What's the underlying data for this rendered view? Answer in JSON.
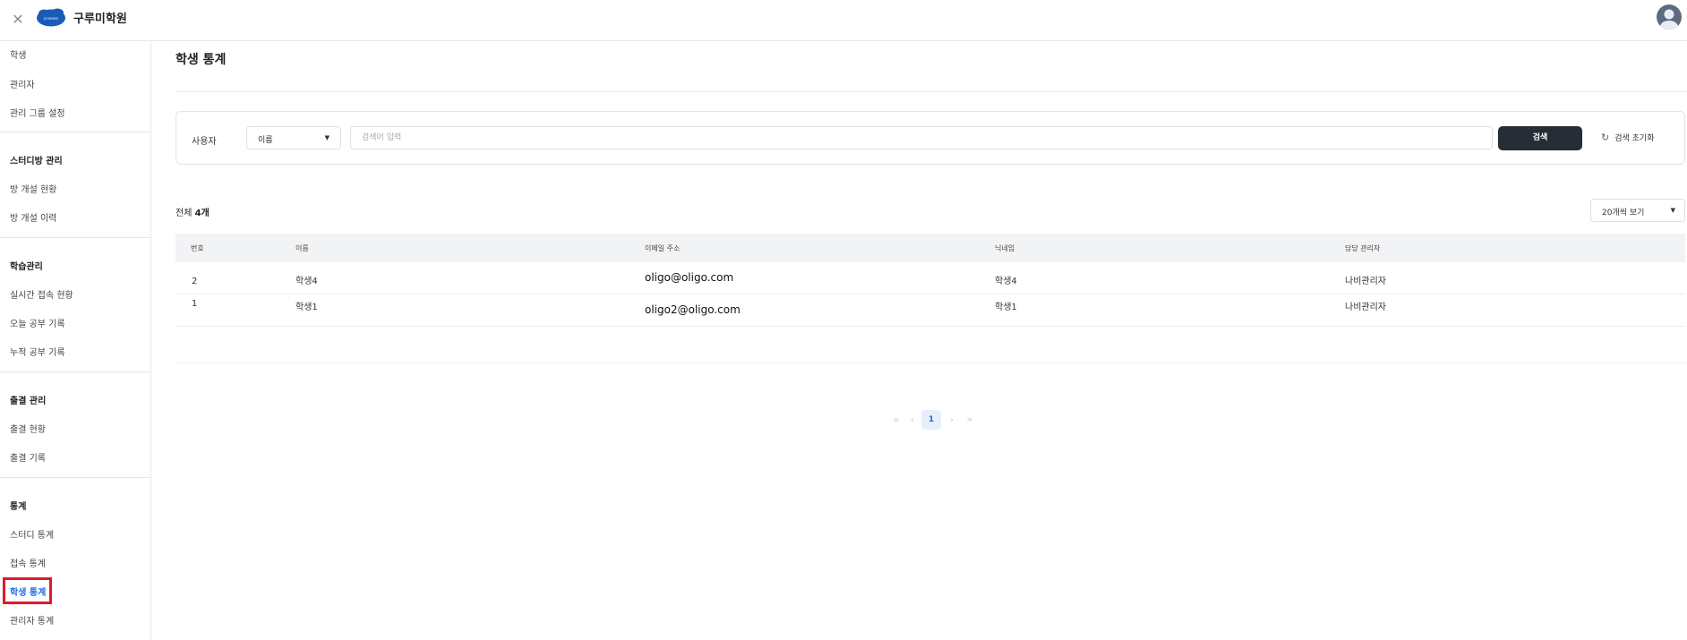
{
  "app": {
    "brand": "구루미학원",
    "logo_text": "GOORMEE"
  },
  "sidebar": {
    "items_top": [
      "학생",
      "관리자",
      "관리 그룹 설정"
    ],
    "groups": [
      {
        "title": "스터디방 관리",
        "items": [
          "방 개설 현황",
          "방 개설 이력"
        ]
      },
      {
        "title": "학습관리",
        "items": [
          "실시간 접속 현황",
          "오늘 공부 기록",
          "누적 공부 기록"
        ]
      },
      {
        "title": "출결 관리",
        "items": [
          "출결 현황",
          "출결 기록"
        ]
      },
      {
        "title": "통계",
        "items": [
          "스터디 통계",
          "접속 통계",
          "학생 통계",
          "관리자 통계"
        ]
      }
    ],
    "active": "학생 통계"
  },
  "page": {
    "title": "학생 통계"
  },
  "search": {
    "label": "사용자",
    "select_value": "이름",
    "placeholder": "검색어 입력",
    "button": "검색",
    "reset": "검색 초기화"
  },
  "list": {
    "count_prefix": "전체",
    "count_value": "4개",
    "per_page": "20개씩 보기"
  },
  "table": {
    "headers": [
      "번호",
      "이름",
      "이메일 주소",
      "닉네임",
      "담당 관리자"
    ],
    "rows": [
      {
        "no": "2",
        "name": "학생4",
        "email": "oligo@oligo.com",
        "nickname": "학생4",
        "manager": "나비관리자"
      },
      {
        "no": "1",
        "name": "학생1",
        "email": "oligo2@oligo.com",
        "nickname": "학생1",
        "manager": "나비관리자"
      }
    ]
  },
  "pagination": {
    "current": "1"
  },
  "colors": {
    "accent": "#1e6fe6",
    "button_dark": "#262d36",
    "highlight": "#e0182d"
  },
  "icons": [
    "close-icon",
    "logo",
    "avatar-icon",
    "caret-down-icon",
    "refresh-icon",
    "chevron-double-left-icon",
    "chevron-left-icon",
    "chevron-right-icon",
    "chevron-double-right-icon"
  ]
}
